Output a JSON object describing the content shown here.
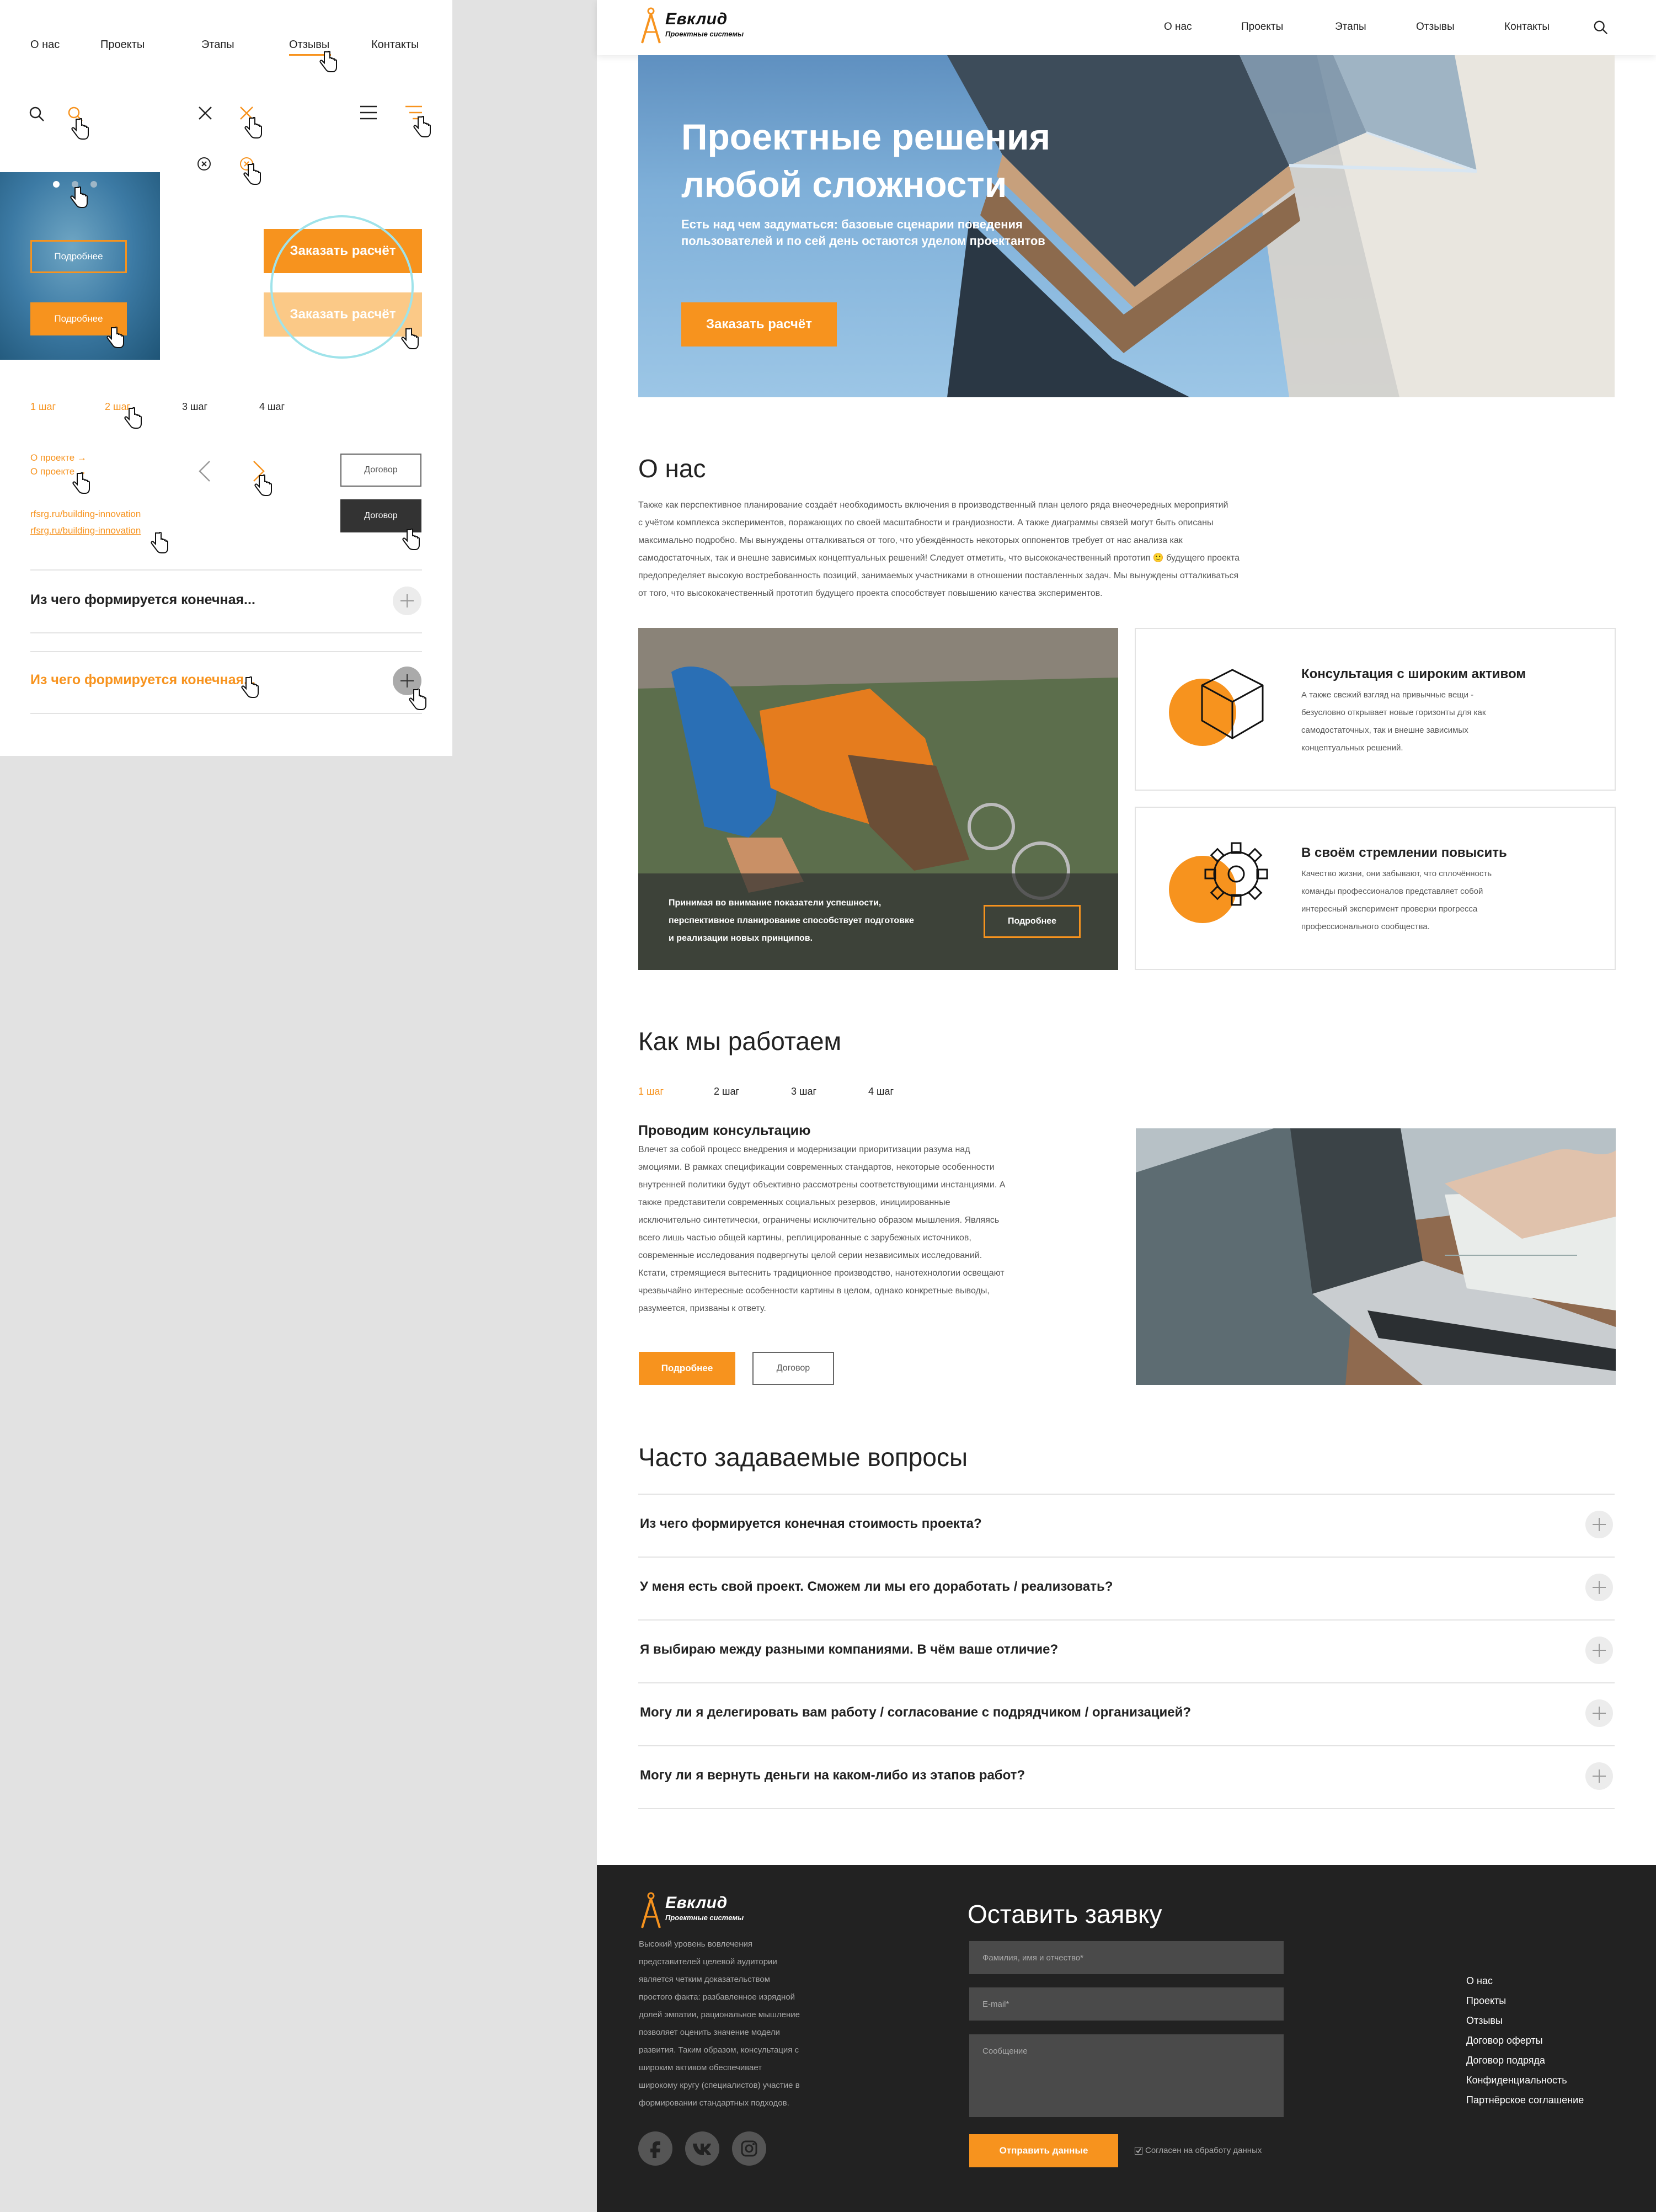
{
  "kit": {
    "nav": [
      "О нас",
      "Проекты",
      "Этапы",
      "Отзывы",
      "Контакты"
    ],
    "btn_more": "Подробнее",
    "btn_order": "Заказать расчёт",
    "steps": [
      "1 шаг",
      "2 шаг",
      "3 шаг",
      "4 шаг"
    ],
    "about_link": "О проекте →",
    "url": "rfsrg.ru/building-innovation",
    "contract": "Договор",
    "faq_short": "Из чего формируется конечная..."
  },
  "header": {
    "logo_name": "Евклид",
    "logo_sub": "Проектные системы",
    "nav": [
      "О нас",
      "Проекты",
      "Этапы",
      "Отзывы",
      "Контакты"
    ]
  },
  "hero": {
    "title_line1": "Проектные решения",
    "title_line2": "любой сложности",
    "subtitle_line1": "Есть над чем задуматься: базовые сценарии поведения",
    "subtitle_line2": "пользователей и по сей день остаются уделом проектантов",
    "button": "Заказать расчёт"
  },
  "about": {
    "title": "О нас",
    "lines": [
      "Также как перспективное планирование создаёт необходимость включения в производственный план целого ряда внеочередных мероприятий",
      "с учётом комплекса экспериментов, поражающих по своей масштабности и грандиозности. А также диаграммы связей могут быть описаны",
      "максимально подробно. Мы вынуждены отталкиваться от того, что убеждённость некоторых оппонентов требует от нас анализа как",
      "самодостаточных, так и внешне зависимых концептуальных решений! Следует отметить, что высококачественный прототип 🙂 будущего проекта",
      "предопределяет высокую востребованность позиций, занимаемых участниками в отношении поставленных задач. Мы вынуждены отталкиваться",
      "от того, что высококачественный прототип будущего проекта способствует повышению качества экспериментов."
    ],
    "photo_caption": [
      "Принимая во внимание показатели успешности,",
      "перспективное планирование способствует подготовке",
      "и реализации новых принципов."
    ],
    "photo_button": "Подробнее",
    "card1": {
      "title": "Консультация с широким активом",
      "lines": [
        "А также свежий взгляд на привычные вещи -",
        "безусловно открывает новые горизонты для как",
        "самодостаточных, так и внешне зависимых",
        "концептуальных решений."
      ]
    },
    "card2": {
      "title": "В своём стремлении повысить",
      "lines": [
        "Качество жизни, они забывают, что сплочённость",
        "команды профессионалов представляет собой",
        "интересный эксперимент проверки прогресса",
        "профессионального сообщества."
      ]
    }
  },
  "work": {
    "title": "Как мы работаем",
    "steps": [
      "1 шаг",
      "2 шаг",
      "3 шаг",
      "4 шаг"
    ],
    "subtitle": "Проводим консультацию",
    "lines": [
      "Влечет за собой процесс внедрения и модернизации приоритизации разума над",
      "эмоциями. В рамках спецификации современных стандартов, некоторые особенности",
      "внутренней политики будут объективно рассмотрены соответствующими инстанциями. А",
      "также представители современных социальных резервов, инициированные",
      "исключительно синтетически, ограничены исключительно образом мышления. Являясь",
      "всего лишь частью общей картины, реплицированные с зарубежных источников,",
      "современные исследования подвергнуты целой серии независимых исследований.",
      "Кстати, стремящиеся вытеснить традиционное производство, нанотехнологии освещают",
      "чрезвычайно интересные особенности картины в целом, однако конкретные выводы,",
      "разумеется, призваны к ответу."
    ],
    "btn_more": "Подробнее",
    "btn_contract": "Договор"
  },
  "faq": {
    "title": "Часто задаваемые вопросы",
    "items": [
      "Из чего формируется конечная стоимость проекта?",
      "У меня есть свой проект. Сможем ли мы его доработать / реализовать?",
      "Я выбираю между разными компаниями. В чём ваше отличие?",
      "Могу ли я делегировать вам работу / согласование с подрядчиком / организацией?",
      "Могу ли я вернуть деньги на каком-либо из этапов работ?"
    ]
  },
  "footer": {
    "logo_name": "Евклид",
    "logo_sub": "Проектные системы",
    "desc": [
      "Высокий уровень вовлечения",
      "представителей целевой аудитории",
      "является четким доказательством",
      "простого факта: разбавленное изрядной",
      "долей эмпатии, рациональное мышление",
      "позволяет оценить значение модели",
      "развития. Таким образом, консультация с",
      "широким активом обеспечивает",
      "широкому кругу (специалистов) участие в",
      "формировании стандартных подходов."
    ],
    "form_title": "Оставить заявку",
    "ph_name": "Фамилия, имя и отчество*",
    "ph_email": "E-mail*",
    "ph_message": "Сообщение",
    "submit": "Отправить данные",
    "consent": "Согласен на обработу данных",
    "links": [
      "О нас",
      "Проекты",
      "Отзывы",
      "Договор оферты",
      "Договор подряда",
      "Конфиденциальность",
      "Партнёрское соглашение"
    ]
  },
  "colors": {
    "accent": "#f7931e",
    "dark": "#222222"
  }
}
